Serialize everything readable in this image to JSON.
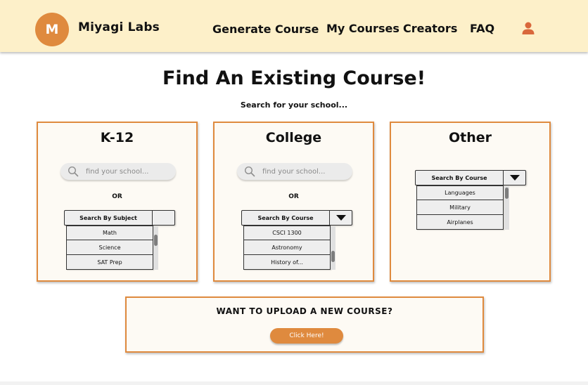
{
  "colors": {
    "accent": "#df8a3e",
    "header_bg": "#fdf0c9",
    "user_icon": "#d9683c"
  },
  "brand": {
    "logo_letter": "M",
    "name": "Miyagi Labs"
  },
  "nav": {
    "generate": "Generate Course",
    "my_courses": "My Courses",
    "creators": "Creators",
    "faq": "FAQ"
  },
  "page": {
    "title": "Find An Existing Course!",
    "subtitle": "Search for your school..."
  },
  "cards": [
    {
      "title": "K-12",
      "search_placeholder": "find your school...",
      "or": "OR",
      "dropdown_label": "Search By Subject",
      "items": [
        "Math",
        "Science",
        "SAT Prep"
      ]
    },
    {
      "title": "College",
      "search_placeholder": "find your school...",
      "or": "OR",
      "dropdown_label": "Search By Course",
      "items": [
        "CSCI 1300",
        "Astronomy",
        "History of..."
      ]
    },
    {
      "title": "Other",
      "dropdown_label": "Search By Course",
      "items": [
        "Languages",
        "Military",
        "Airplanes"
      ]
    }
  ],
  "upload": {
    "title": "WANT TO UPLOAD A NEW COURSE?",
    "button": "Click Here!"
  }
}
